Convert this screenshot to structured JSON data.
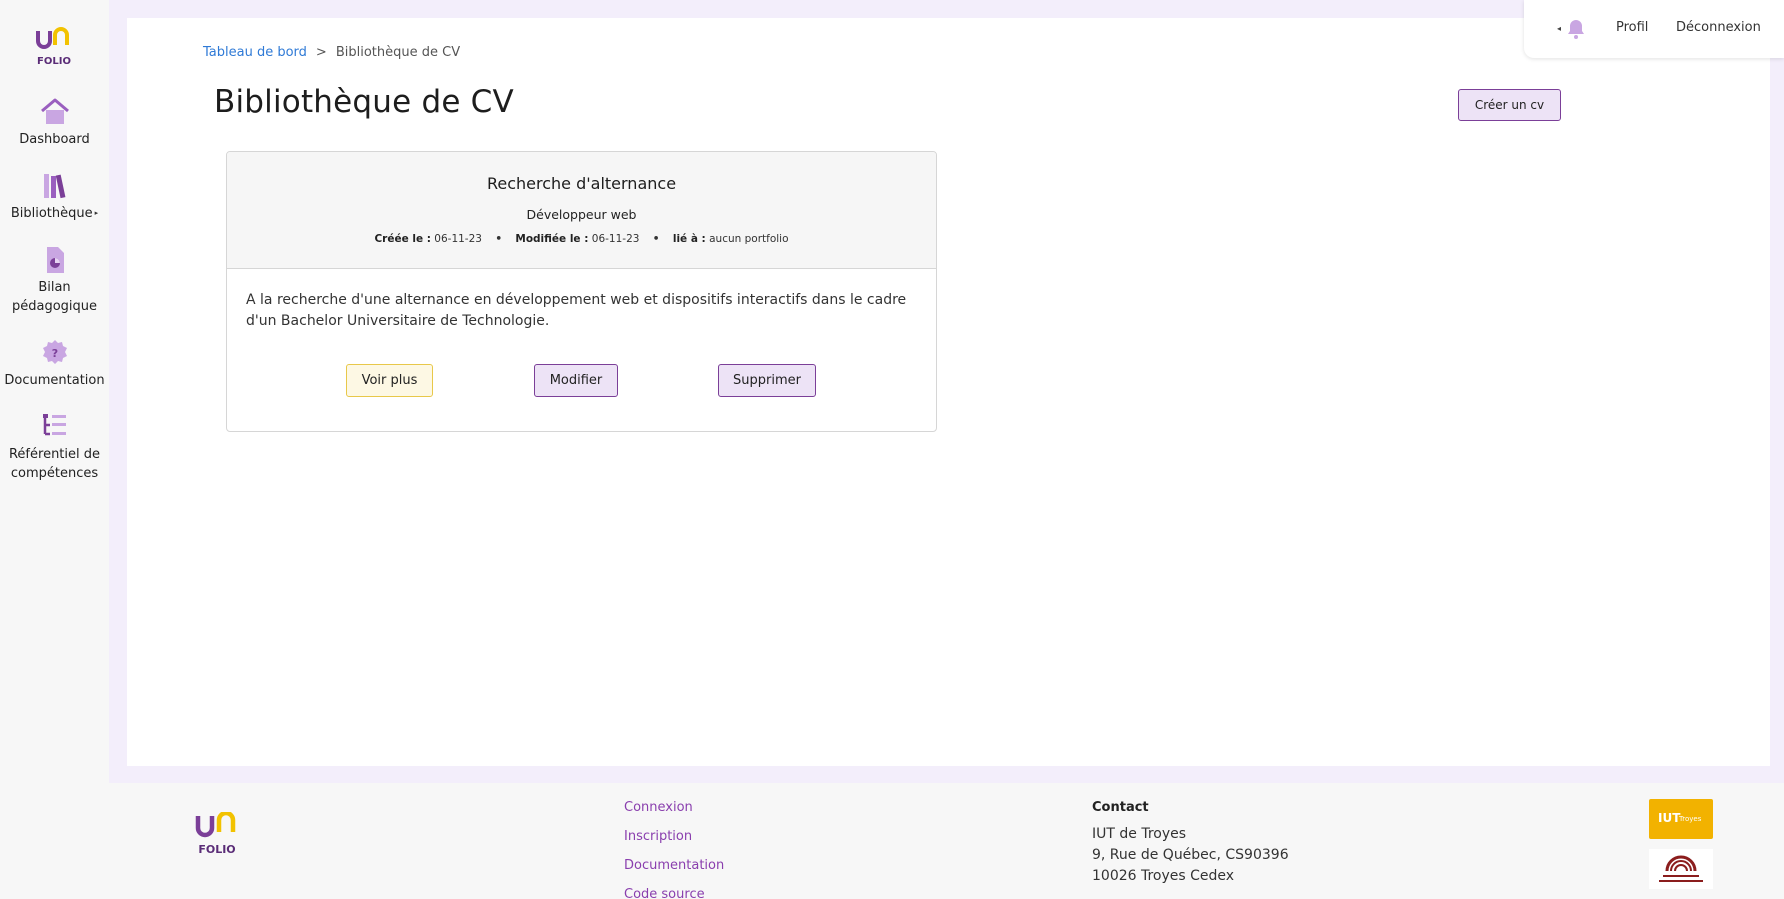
{
  "sidebar": {
    "items": [
      {
        "label": "Dashboard",
        "icon": "home-icon"
      },
      {
        "label": "Bibliothèque",
        "icon": "library-icon",
        "has_submenu": true
      },
      {
        "label_line1": "Bilan",
        "label_line2": "pédagogique",
        "icon": "report-icon"
      },
      {
        "label": "Documentation",
        "icon": "help-icon"
      },
      {
        "label_line1": "Référentiel de",
        "label_line2": "compétences",
        "icon": "tree-list-icon"
      }
    ]
  },
  "header": {
    "profile_label": "Profil",
    "logout_label": "Déconnexion"
  },
  "breadcrumb": {
    "parent": "Tableau de bord",
    "separator": ">",
    "current": "Bibliothèque de CV"
  },
  "page": {
    "title": "Bibliothèque de CV",
    "create_button": "Créer un cv"
  },
  "cv": {
    "title": "Recherche d'alternance",
    "subtitle": "Développeur web",
    "created_label": "Créée le :",
    "created_value": "06-11-23",
    "modified_label": "Modifiée le :",
    "modified_value": "06-11-23",
    "linked_label": "lié à :",
    "linked_value": "aucun portfolio",
    "description": "A la recherche d'une alternance en développement web et dispositifs interactifs dans le cadre d'un Bachelor Universitaire de Technologie.",
    "btn_view": "Voir plus",
    "btn_edit": "Modifier",
    "btn_delete": "Supprimer"
  },
  "footer": {
    "links": [
      "Connexion",
      "Inscription",
      "Documentation",
      "Code source"
    ],
    "contact_heading": "Contact",
    "contact_lines": [
      "IUT de Troyes",
      "9, Rue de Québec, CS90396",
      "10026 Troyes Cedex"
    ],
    "iut_logo_text": "IUT",
    "iut_logo_sub": "Troyes"
  },
  "colors": {
    "brand_purple": "#7b3f98",
    "brand_yellow": "#f2c200",
    "link_blue": "#2f7ad6",
    "footer_link": "#8a3fae"
  }
}
